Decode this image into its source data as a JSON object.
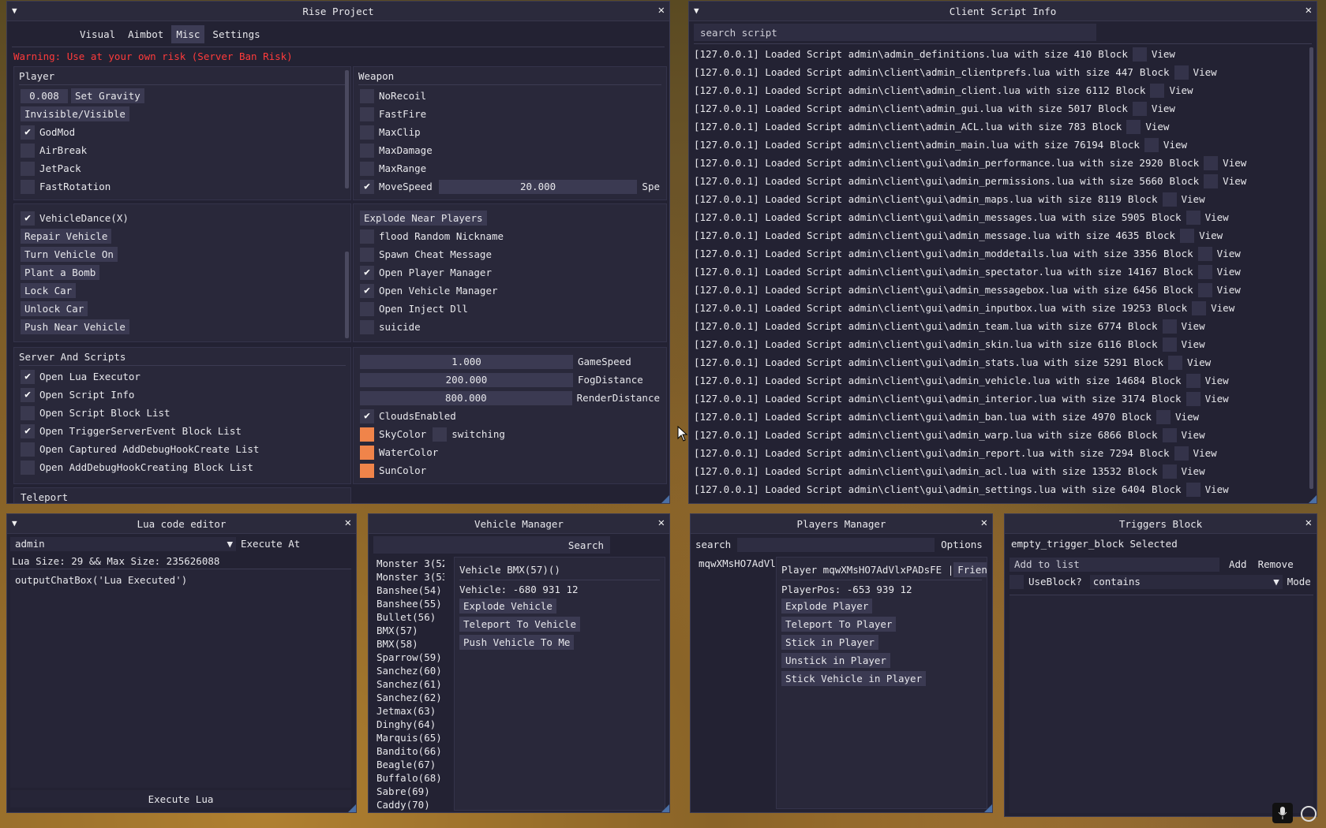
{
  "rise": {
    "title": "Rise Project",
    "tabs": [
      "Visual",
      "Aimbot",
      "Misc",
      "Settings"
    ],
    "active_tab": "Misc",
    "warning": "Warning: Use at your own risk (Server Ban Risk)",
    "player": {
      "header": "Player",
      "gravity_value": "0.008",
      "set_gravity": "Set Gravity",
      "invisible": "Invisible/Visible",
      "items": [
        {
          "label": "GodMod",
          "checked": true
        },
        {
          "label": "AirBreak",
          "checked": false
        },
        {
          "label": "JetPack",
          "checked": false
        },
        {
          "label": "FastRotation",
          "checked": false
        }
      ]
    },
    "vehicle": {
      "dance": "VehicleDance(X)",
      "buttons": [
        "Repair Vehicle",
        "Turn Vehicle On",
        "Plant a Bomb",
        "Lock Car",
        "Unlock Car",
        "Push Near Vehicle"
      ]
    },
    "server": {
      "header": "Server And Scripts",
      "items": [
        {
          "label": "Open Lua Executor",
          "checked": true
        },
        {
          "label": "Open Script Info",
          "checked": true
        },
        {
          "label": "Open Script Block List",
          "checked": false
        },
        {
          "label": "Open TriggerServerEvent Block List",
          "checked": true
        },
        {
          "label": "Open Captured AddDebugHookCreate List",
          "checked": false
        },
        {
          "label": "Open AddDebugHookCreating Block List",
          "checked": false
        }
      ]
    },
    "teleport": "Teleport",
    "weapon": {
      "header": "Weapon",
      "items": [
        {
          "label": "NoRecoil",
          "checked": false
        },
        {
          "label": "FastFire",
          "checked": false
        },
        {
          "label": "MaxClip",
          "checked": false
        },
        {
          "label": "MaxDamage",
          "checked": false
        },
        {
          "label": "MaxRange",
          "checked": false
        }
      ],
      "movespeed_label": "MoveSpeed",
      "movespeed_value": "20.000",
      "movespeed_suffix": "Spe"
    },
    "explode": {
      "button": "Explode Near Players",
      "items": [
        {
          "label": "flood Random Nickname",
          "checked": false
        },
        {
          "label": "Spawn Cheat Message",
          "checked": false
        },
        {
          "label": "Open Player Manager",
          "checked": true
        },
        {
          "label": "Open Vehicle Manager",
          "checked": true
        },
        {
          "label": "Open Inject Dll",
          "checked": false
        },
        {
          "label": "suicide",
          "checked": false
        }
      ]
    },
    "world": {
      "sliders": [
        {
          "value": "1.000",
          "label": "GameSpeed"
        },
        {
          "value": "200.000",
          "label": "FogDistance"
        },
        {
          "value": "800.000",
          "label": "RenderDistance"
        }
      ],
      "clouds": "CloudsEnabled",
      "skycolor": "SkyColor",
      "switching": "switching",
      "watercolor": "WaterColor",
      "suncolor": "SunColor",
      "color": "#f0844a"
    }
  },
  "client_script": {
    "title": "Client Script Info",
    "search_placeholder": "search script",
    "block": "Block",
    "view": "View",
    "rows": [
      "[127.0.0.1] Loaded Script admin\\admin_definitions.lua with size 410",
      "[127.0.0.1] Loaded Script admin\\client\\admin_clientprefs.lua with size 447",
      "[127.0.0.1] Loaded Script admin\\client\\admin_client.lua with size 6112",
      "[127.0.0.1] Loaded Script admin\\client\\admin_gui.lua with size 5017",
      "[127.0.0.1] Loaded Script admin\\client\\admin_ACL.lua with size 783",
      "[127.0.0.1] Loaded Script admin\\client\\admin_main.lua with size 76194",
      "[127.0.0.1] Loaded Script admin\\client\\gui\\admin_performance.lua with size 2920",
      "[127.0.0.1] Loaded Script admin\\client\\gui\\admin_permissions.lua with size 5660",
      "[127.0.0.1] Loaded Script admin\\client\\gui\\admin_maps.lua with size 8119",
      "[127.0.0.1] Loaded Script admin\\client\\gui\\admin_messages.lua with size 5905",
      "[127.0.0.1] Loaded Script admin\\client\\gui\\admin_message.lua with size 4635",
      "[127.0.0.1] Loaded Script admin\\client\\gui\\admin_moddetails.lua with size 3356",
      "[127.0.0.1] Loaded Script admin\\client\\gui\\admin_spectator.lua with size 14167",
      "[127.0.0.1] Loaded Script admin\\client\\gui\\admin_messagebox.lua with size 6456",
      "[127.0.0.1] Loaded Script admin\\client\\gui\\admin_inputbox.lua with size 19253",
      "[127.0.0.1] Loaded Script admin\\client\\gui\\admin_team.lua with size 6774",
      "[127.0.0.1] Loaded Script admin\\client\\gui\\admin_skin.lua with size 6116",
      "[127.0.0.1] Loaded Script admin\\client\\gui\\admin_stats.lua with size 5291",
      "[127.0.0.1] Loaded Script admin\\client\\gui\\admin_vehicle.lua with size 14684",
      "[127.0.0.1] Loaded Script admin\\client\\gui\\admin_interior.lua with size 3174",
      "[127.0.0.1] Loaded Script admin\\client\\gui\\admin_ban.lua with size 4970",
      "[127.0.0.1] Loaded Script admin\\client\\gui\\admin_warp.lua with size 6866",
      "[127.0.0.1] Loaded Script admin\\client\\gui\\admin_report.lua with size 7294",
      "[127.0.0.1] Loaded Script admin\\client\\gui\\admin_acl.lua with size 13532",
      "[127.0.0.1] Loaded Script admin\\client\\gui\\admin_settings.lua with size 6404"
    ]
  },
  "lua": {
    "title": "Lua code editor",
    "resource": "admin",
    "execute_at": "Execute At",
    "size_info": "Lua Size: 29 && Max Size: 235626088",
    "code": "outputChatBox('Lua Executed')",
    "execute": "Execute Lua"
  },
  "vehicle_mgr": {
    "title": "Vehicle Manager",
    "search": "Search",
    "list": [
      "Monster 3(52",
      "Monster 3(53",
      "Banshee(54)",
      "Banshee(55)",
      "Bullet(56)",
      "BMX(57)",
      "BMX(58)",
      "Sparrow(59)",
      "Sanchez(60)",
      "Sanchez(61)",
      "Sanchez(62)",
      "Jetmax(63)",
      "Dinghy(64)",
      "Marquis(65)",
      "Bandito(66)",
      "Beagle(67)",
      "Buffalo(68)",
      "Sabre(69)",
      "Caddy(70)"
    ],
    "selected": "Vehicle BMX(57)()",
    "pos": "Vehicle: -680 931 12",
    "buttons": [
      "Explode Vehicle",
      "Teleport To Vehicle",
      "Push Vehicle To Me"
    ]
  },
  "players_mgr": {
    "title": "Players Manager",
    "search": "search",
    "options": "Options",
    "player_short": "mqwXMsHO7AdVl",
    "player_full": "Player mqwXMsHO7AdVlxPADsFE |",
    "friend": "Frien",
    "pos": "PlayerPos: -653 939 12",
    "buttons": [
      "Explode Player",
      "Teleport To Player",
      "Stick in Player",
      "Unstick in Player",
      "Stick Vehicle in Player"
    ]
  },
  "triggers": {
    "title": "Triggers Block",
    "selected": "empty_trigger_block Selected",
    "add_placeholder": "Add to list",
    "add": "Add",
    "remove": "Remove",
    "useblock": "UseBlock?",
    "mode_value": "contains",
    "mode": "Mode"
  }
}
